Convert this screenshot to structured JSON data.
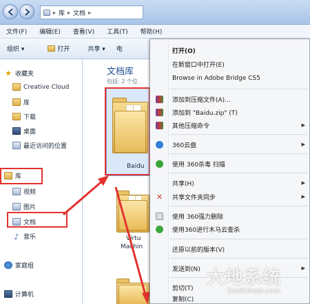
{
  "address": {
    "crumbs": [
      "库",
      "文档"
    ]
  },
  "menubar": [
    {
      "label": "文件(F)"
    },
    {
      "label": "编辑(E)"
    },
    {
      "label": "查看(V)"
    },
    {
      "label": "工具(T)"
    },
    {
      "label": "帮助(H)"
    }
  ],
  "toolbar": {
    "organize": "组织 ▾",
    "open": "打开",
    "share": "共享 ▾",
    "more": "电"
  },
  "navpane": {
    "favorites": "收藏夹",
    "creative_cloud": "Creative Cloud",
    "lib_fav": "库",
    "download": "下载",
    "desktop": "桌面",
    "recent": "最近访问的位置",
    "libraries": "库",
    "video": "视频",
    "pictures": "图片",
    "documents": "文档",
    "music": "音乐",
    "homegroup": "家庭组",
    "computer": "计算机"
  },
  "content": {
    "title": "文档库",
    "subtitle": "包括: 2 个位",
    "folder1": "Baidu",
    "folder2_line1": "Virtu",
    "folder2_line2": "Machin"
  },
  "context_menu": [
    {
      "label": "打开(O)",
      "bold": true,
      "icon": "none"
    },
    {
      "label": "在新窗口中打开(E)",
      "icon": "none"
    },
    {
      "label": "Browse in Adobe Bridge CS5",
      "icon": "none"
    },
    {
      "label": "添加到压缩文件(A)...",
      "icon": "winrar-icon"
    },
    {
      "label": "添加到 \"Baidu.zip\" (T)",
      "icon": "winrar-icon"
    },
    {
      "label": "其他压缩命令",
      "icon": "winrar-icon",
      "submenu": true
    },
    {
      "label": "360云盘",
      "icon": "cloud-icon",
      "submenu": true
    },
    {
      "label": "使用 360杀毒 扫描",
      "icon": "shield-icon"
    },
    {
      "label": "共享(H)",
      "icon": "none",
      "submenu": true
    },
    {
      "label": "共享文件夹同步",
      "icon": "sync-icon",
      "submenu": true
    },
    {
      "label": "使用 360强力删除",
      "icon": "delete-icon"
    },
    {
      "label": "使用360进行木马云查杀",
      "icon": "scan-icon"
    },
    {
      "label": "还原以前的版本(V)",
      "icon": "none"
    },
    {
      "label": "发送到(N)",
      "icon": "none",
      "submenu": true
    },
    {
      "label": "剪切(T)",
      "icon": "none"
    },
    {
      "label": "复制(C)",
      "icon": "none"
    }
  ],
  "watermark": {
    "brand": "大地系统",
    "site": "DadiGhost.com"
  },
  "colors": {
    "annotation_red": "#e3312d",
    "library_title": "#1f4f8f",
    "menu_bg": "#f5f6f8"
  }
}
